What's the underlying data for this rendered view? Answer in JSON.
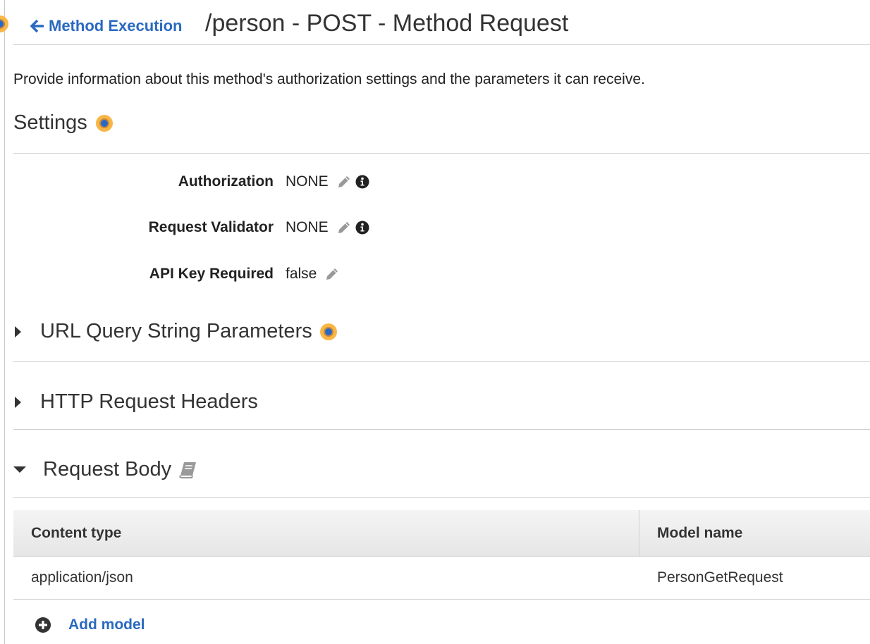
{
  "header": {
    "back_link_label": "Method Execution",
    "title": "/person - POST - Method Request"
  },
  "description": "Provide information about this method's authorization settings and the parameters it can receive.",
  "settings": {
    "title": "Settings",
    "rows": [
      {
        "label": "Authorization",
        "value": "NONE",
        "editable": true,
        "info": true
      },
      {
        "label": "Request Validator",
        "value": "NONE",
        "editable": true,
        "info": true
      },
      {
        "label": "API Key Required",
        "value": "false",
        "editable": true,
        "info": false
      }
    ]
  },
  "sections": {
    "url_query": {
      "label": "URL Query String Parameters",
      "expanded": false
    },
    "http_headers": {
      "label": "HTTP Request Headers",
      "expanded": false
    },
    "request_body": {
      "label": "Request Body",
      "expanded": true
    }
  },
  "request_body_table": {
    "columns": [
      "Content type",
      "Model name"
    ],
    "rows": [
      {
        "content_type": "application/json",
        "model_name": "PersonGetRequest"
      }
    ]
  },
  "add_model_label": "Add model",
  "colors": {
    "link": "#2a6ac0",
    "help_dot_outer": "#f8b646",
    "help_dot_inner": "#2a68c8"
  }
}
